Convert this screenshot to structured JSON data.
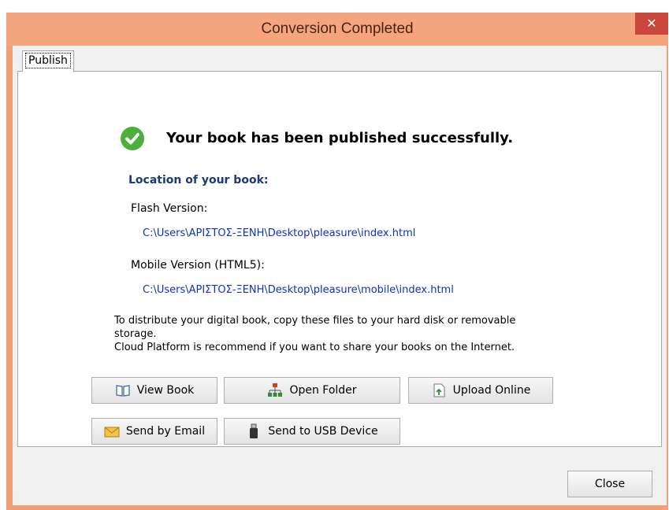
{
  "window": {
    "title": "Conversion Completed"
  },
  "tabs": [
    {
      "label": "Publish"
    }
  ],
  "content": {
    "headline": "Your book has been published successfully.",
    "location_label": "Location of your book:",
    "flash_label": "Flash Version:",
    "flash_path": "C:\\Users\\ΑΡΙΣΤΟΣ-ΞΕΝΗ\\Desktop\\pleasure\\index.html",
    "mobile_label": "Mobile Version (HTML5):",
    "mobile_path": "C:\\Users\\ΑΡΙΣΤΟΣ-ΞΕΝΗ\\Desktop\\pleasure\\mobile\\index.html",
    "distribute_line1": "To distribute your digital book, copy these files to your hard disk or removable",
    "distribute_line2": "storage.",
    "distribute_line3": "Cloud Platform is recommend if you want to share your books on the Internet."
  },
  "buttons": {
    "view_book": "View Book",
    "open_folder": "Open Folder",
    "upload_online": "Upload Online",
    "send_email": "Send by Email",
    "send_usb": "Send to USB Device",
    "close": "Close"
  },
  "colors": {
    "title_bar": "#f5a57e",
    "close_button": "#c9473d",
    "link_text": "#1030c0",
    "success": "#4caf3a"
  }
}
